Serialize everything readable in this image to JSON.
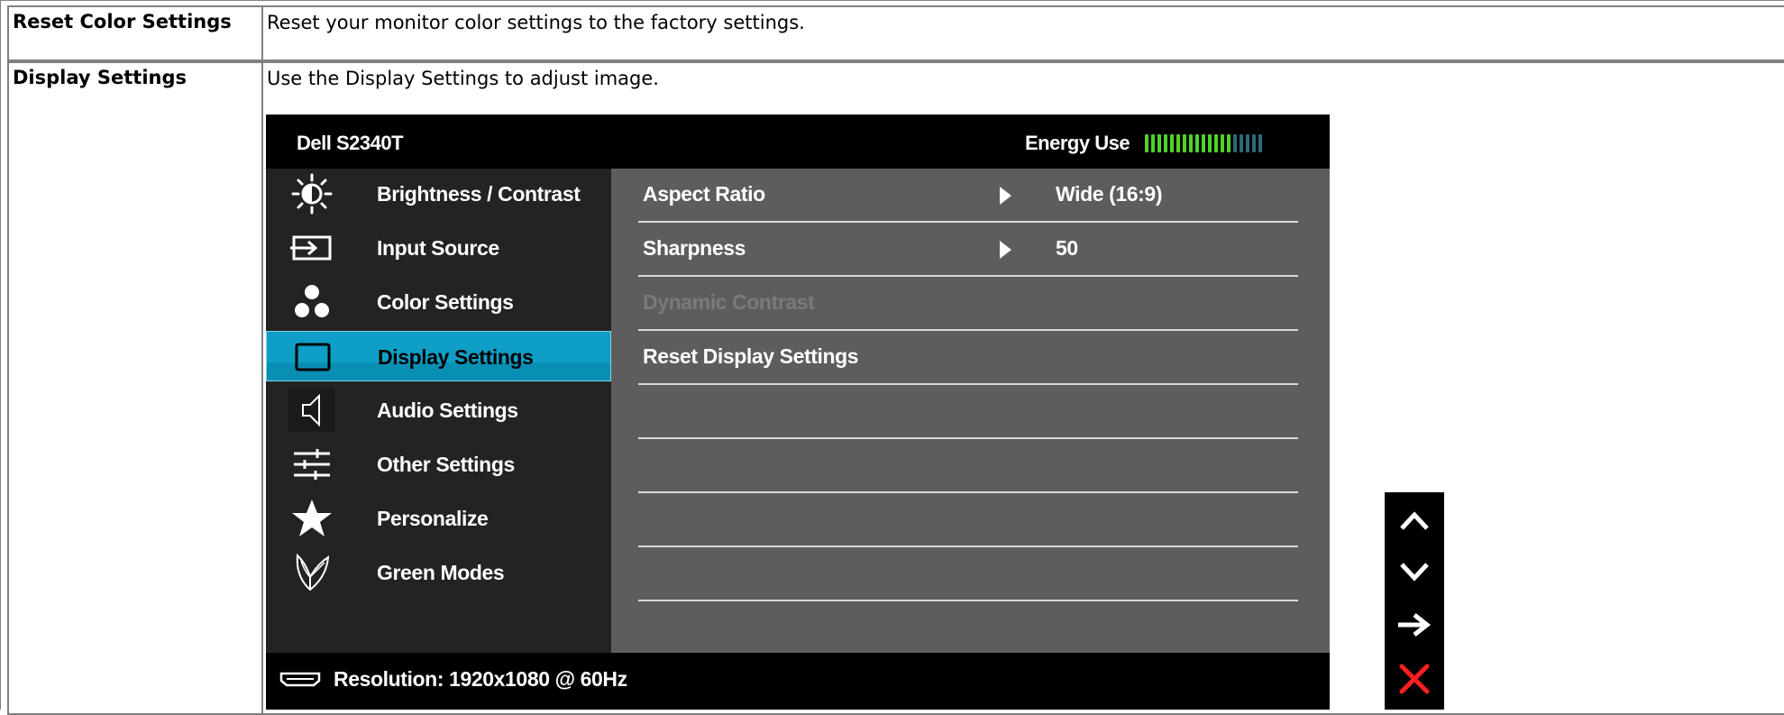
{
  "rows": [
    {
      "term": "Reset Color Settings",
      "description": "Reset your monitor color settings to the factory settings."
    },
    {
      "term": "Display Settings",
      "description": "Use the Display Settings to adjust image."
    }
  ],
  "osd": {
    "model": "Dell S2340T",
    "energy_label": "Energy Use",
    "energy_level": 0.74,
    "colors": {
      "active": "#0f9fc6",
      "energy_on": "#4ed32c",
      "energy_off": "#2c6a78",
      "close": "#ff1f1f"
    },
    "menu": [
      {
        "label": "Brightness / Contrast",
        "icon": "brightness-icon"
      },
      {
        "label": "Input Source",
        "icon": "input-source-icon"
      },
      {
        "label": "Color Settings",
        "icon": "color-settings-icon"
      },
      {
        "label": "Display Settings",
        "icon": "display-settings-icon",
        "selected": true
      },
      {
        "label": "Audio Settings",
        "icon": "speaker-icon"
      },
      {
        "label": "Other Settings",
        "icon": "sliders-icon"
      },
      {
        "label": "Personalize",
        "icon": "star-icon"
      },
      {
        "label": "Green Modes",
        "icon": "leaf-icon"
      }
    ],
    "settings": [
      {
        "name": "Aspect Ratio",
        "value": "Wide (16:9)"
      },
      {
        "name": "Sharpness",
        "value": "50"
      },
      {
        "name": "Dynamic Contrast",
        "value": "",
        "disabled": true
      },
      {
        "name": "Reset Display Settings",
        "value": ""
      }
    ],
    "resolution": "Resolution: 1920x1080 @ 60Hz",
    "buttons": [
      "up-arrow-icon",
      "down-arrow-icon",
      "right-arrow-icon",
      "close-icon"
    ]
  }
}
